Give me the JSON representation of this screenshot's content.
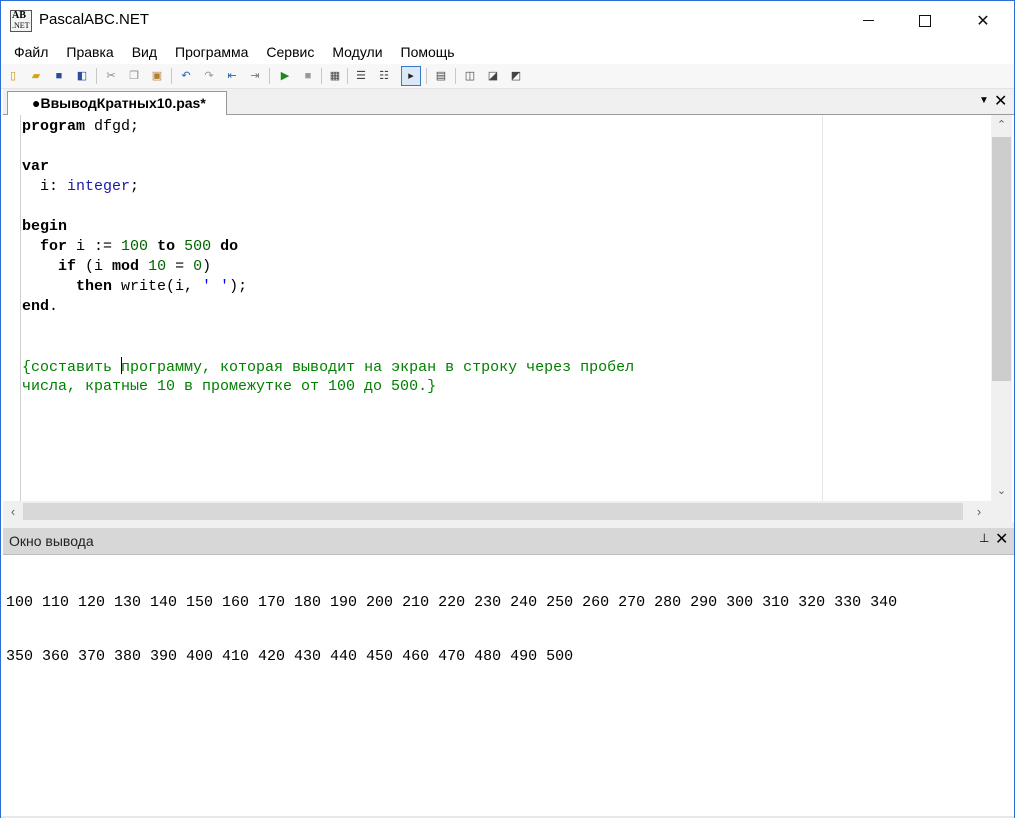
{
  "window": {
    "title": "PascalABC.NET",
    "icon_text_top": "AB",
    "icon_text_bottom": ".NET"
  },
  "menu": [
    "Файл",
    "Правка",
    "Вид",
    "Программа",
    "Сервис",
    "Модули",
    "Помощь"
  ],
  "tab": {
    "label": "●ВвыводКратных10.pas*"
  },
  "code_lines": [
    [
      {
        "t": "program",
        "c": "kw"
      },
      {
        "t": " dfgd;",
        "c": ""
      }
    ],
    [],
    [
      {
        "t": "var",
        "c": "kw"
      }
    ],
    [
      {
        "t": "  i: ",
        "c": ""
      },
      {
        "t": "integer",
        "c": "typ"
      },
      {
        "t": ";",
        "c": ""
      }
    ],
    [],
    [
      {
        "t": "begin",
        "c": "kw"
      }
    ],
    [
      {
        "t": "  ",
        "c": ""
      },
      {
        "t": "for",
        "c": "kw"
      },
      {
        "t": " i := ",
        "c": ""
      },
      {
        "t": "100",
        "c": "num"
      },
      {
        "t": " ",
        "c": ""
      },
      {
        "t": "to",
        "c": "kw"
      },
      {
        "t": " ",
        "c": ""
      },
      {
        "t": "500",
        "c": "num"
      },
      {
        "t": " ",
        "c": ""
      },
      {
        "t": "do",
        "c": "kw"
      }
    ],
    [
      {
        "t": "    ",
        "c": ""
      },
      {
        "t": "if",
        "c": "kw"
      },
      {
        "t": " (i ",
        "c": ""
      },
      {
        "t": "mod",
        "c": "kw"
      },
      {
        "t": " ",
        "c": ""
      },
      {
        "t": "10",
        "c": "num"
      },
      {
        "t": " = ",
        "c": ""
      },
      {
        "t": "0",
        "c": "num"
      },
      {
        "t": ")",
        "c": ""
      }
    ],
    [
      {
        "t": "      ",
        "c": ""
      },
      {
        "t": "then",
        "c": "kw"
      },
      {
        "t": " write(i, ",
        "c": ""
      },
      {
        "t": "' '",
        "c": "str"
      },
      {
        "t": ");",
        "c": ""
      }
    ],
    [
      {
        "t": "end",
        "c": "kw"
      },
      {
        "t": ".",
        "c": ""
      }
    ],
    [],
    [],
    [
      {
        "t": "{составить ",
        "c": "cmt"
      },
      {
        "t": "|caret|",
        "c": "caret"
      },
      {
        "t": "программу, которая выводит на экран в строку через пробел",
        "c": "cmt"
      }
    ],
    [
      {
        "t": "числа, кратные 10 в промежутке от 100 до 500.}",
        "c": "cmt"
      }
    ]
  ],
  "output_panel": {
    "title": "Окно вывода",
    "lines": [
      "100 110 120 130 140 150 160 170 180 190 200 210 220 230 240 250 260 270 280 290 300 310 320 330 340",
      "350 360 370 380 390 400 410 420 430 440 450 460 470 480 490 500"
    ]
  },
  "icons": {
    "toolbar": [
      "new-file-icon",
      "open-folder-icon",
      "save-icon",
      "save-all-icon",
      "cut-icon",
      "copy-icon",
      "paste-icon",
      "undo-icon",
      "redo-icon",
      "indent-icon",
      "unindent-icon",
      "run-icon",
      "stop-icon",
      "compile-icon",
      "step-over-icon",
      "step-into-icon",
      "output-window-icon",
      "debug-icon",
      "format-icon",
      "bookmark-icon",
      "replace-icon"
    ]
  }
}
